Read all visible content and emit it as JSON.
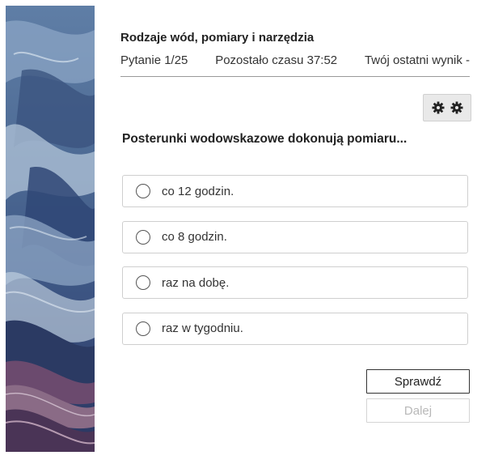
{
  "quiz": {
    "title": "Rodzaje wód, pomiary i narzędzia",
    "question_counter": "Pytanie 1/25",
    "time_remaining": "Pozostało czasu 37:52",
    "last_score": "Twój ostatni wynik -"
  },
  "toolbar": {
    "icons": [
      "gear-icon",
      "gear-icon"
    ]
  },
  "question": {
    "text": "Posterunki wodowskazowe dokonują pomiaru..."
  },
  "answers": [
    {
      "label": "co 12 godzin."
    },
    {
      "label": "co 8 godzin."
    },
    {
      "label": "raz na dobę."
    },
    {
      "label": "raz w tygodniu."
    }
  ],
  "buttons": {
    "check_label": "Sprawdź",
    "next_label": "Dalej"
  },
  "colors": {
    "image_dark_blue": "#24355a",
    "image_light_blue": "#a9bfd6",
    "image_purple": "#6b4a6e",
    "settings_bg": "#e9e9e9"
  }
}
